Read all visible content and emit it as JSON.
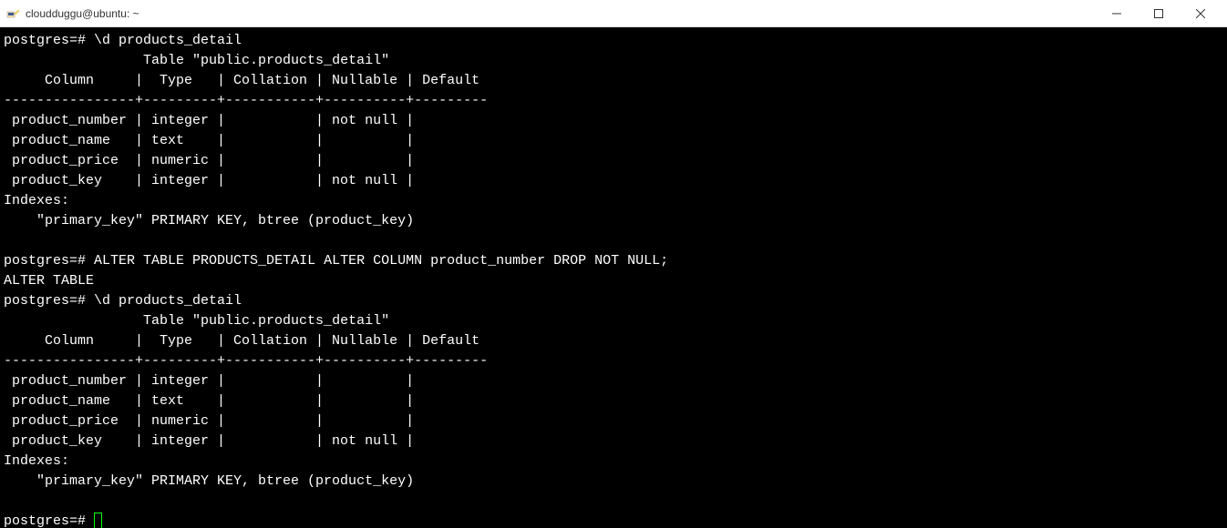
{
  "window": {
    "title": "cloudduggu@ubuntu: ~"
  },
  "terminal": {
    "prompt": "postgres=#",
    "cmd1": "\\d products_detail",
    "table_title": "Table \"public.products_detail\"",
    "headers": "     Column     |  Type   | Collation | Nullable | Default",
    "divider": "----------------+---------+-----------+----------+---------",
    "rows_before": {
      "r1": " product_number | integer |           | not null |",
      "r2": " product_name   | text    |           |          |",
      "r3": " product_price  | numeric |           |          |",
      "r4": " product_key    | integer |           | not null |"
    },
    "indexes_label": "Indexes:",
    "index_line": "    \"primary_key\" PRIMARY KEY, btree (product_key)",
    "cmd2": "ALTER TABLE PRODUCTS_DETAIL ALTER COLUMN product_number DROP NOT NULL;",
    "result2": "ALTER TABLE",
    "cmd3": "\\d products_detail",
    "rows_after": {
      "r1": " product_number | integer |           |          |",
      "r2": " product_name   | text    |           |          |",
      "r3": " product_price  | numeric |           |          |",
      "r4": " product_key    | integer |           | not null |"
    }
  }
}
